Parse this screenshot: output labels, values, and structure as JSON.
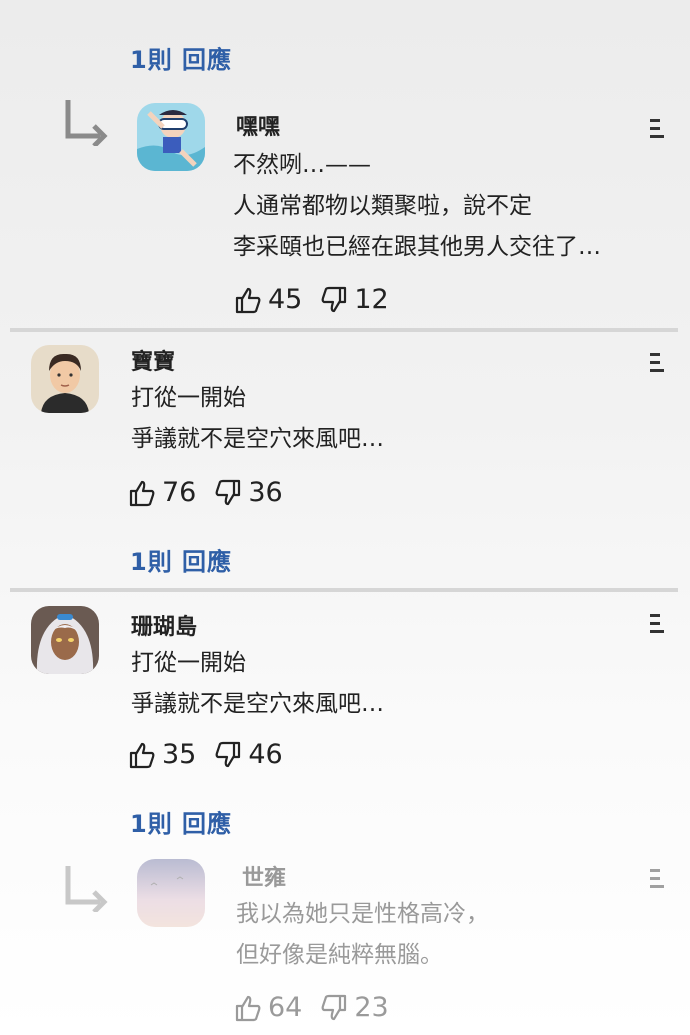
{
  "comments": [
    {
      "username": "嘿嘿",
      "lines": [
        "不然咧…——",
        "人通常都物以類聚啦，說不定",
        "李采頤也已經在跟其他男人交往了…"
      ],
      "likes": "45",
      "dislikes": "12",
      "avatar_icon": "snorkel-diver-avatar"
    },
    {
      "username": "寶寶",
      "lines": [
        "打從一開始",
        "爭議就不是空穴來風吧…"
      ],
      "likes": "76",
      "dislikes": "36",
      "replies_label": "1則 回應",
      "avatar_icon": "young-man-avatar"
    },
    {
      "username": "珊瑚島",
      "lines": [
        "打從一開始",
        "爭議就不是空穴來風吧…"
      ],
      "likes": "35",
      "dislikes": "46",
      "replies_label": "1則 回應",
      "avatar_icon": "white-hair-girl-avatar"
    },
    {
      "username": "世雍",
      "lines": [
        "我以為她只是性格高冷，",
        "但好像是純粹無腦。"
      ],
      "likes": "64",
      "dislikes": "23",
      "avatar_icon": "pastel-sky-avatar"
    }
  ],
  "top_replies_label": "1則 回應",
  "colors": {
    "link": "#2f5fa7",
    "divider": "#d6d6d6"
  }
}
